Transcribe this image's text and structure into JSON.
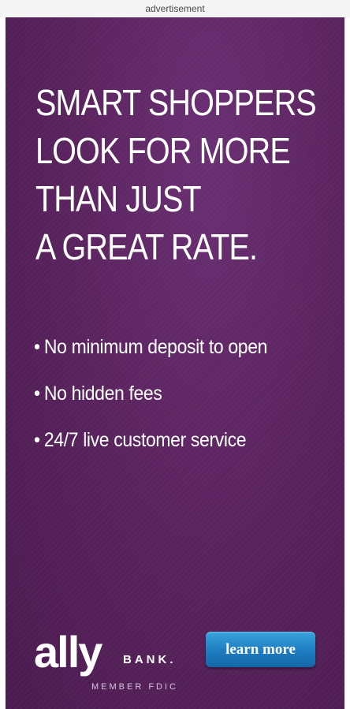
{
  "ad_label": "advertisement",
  "headline": [
    "SMART SHOPPERS",
    "LOOK FOR MORE",
    "THAN JUST",
    "A GREAT RATE."
  ],
  "bullets": [
    "No minimum deposit to open",
    "No hidden fees",
    "24/7 live customer service"
  ],
  "logo": {
    "word": "ally",
    "bank": "BANK.",
    "fdic": "MEMBER FDIC"
  },
  "cta": {
    "label": "learn more"
  },
  "colors": {
    "background": "#5b245f",
    "button": "#1f7fc2",
    "text": "#ffffff"
  }
}
